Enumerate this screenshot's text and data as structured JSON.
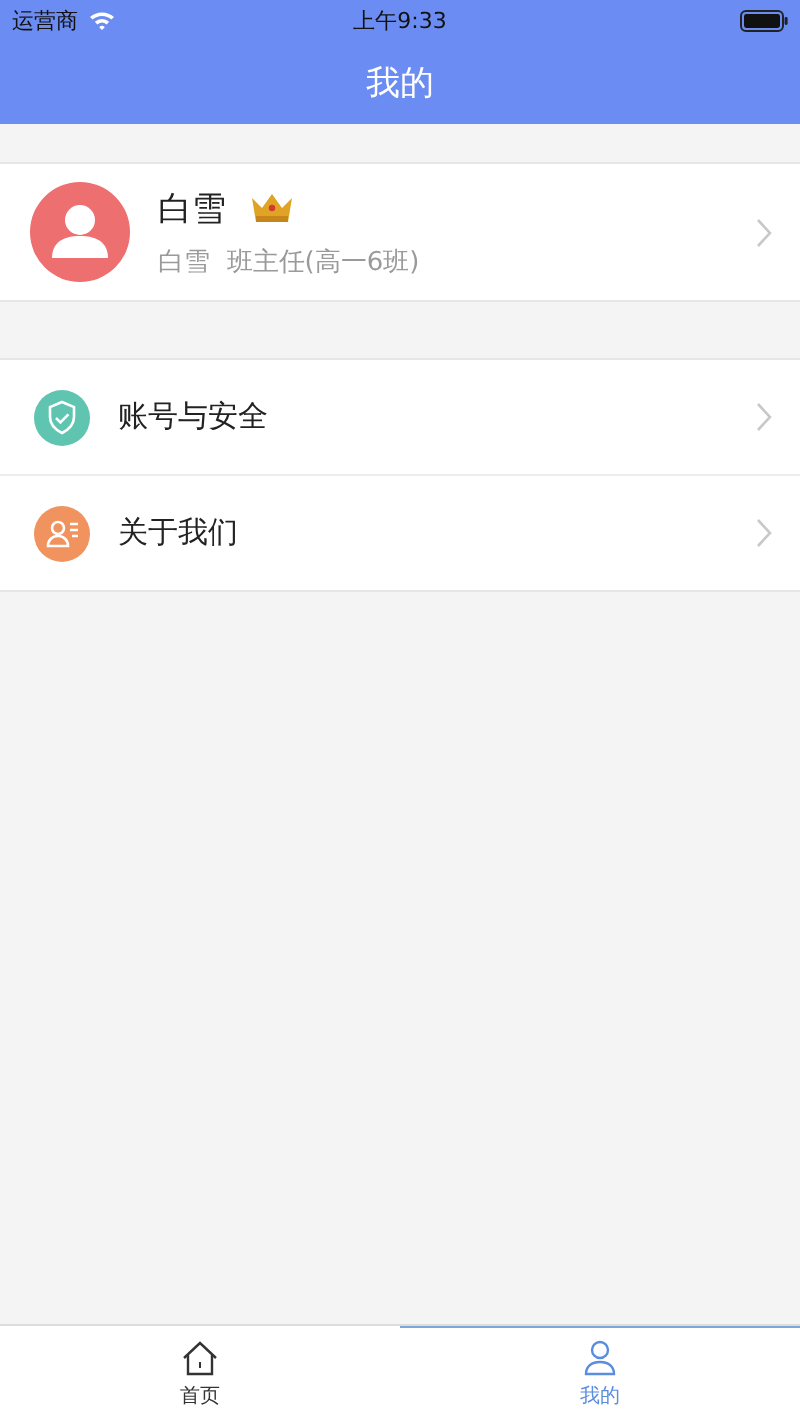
{
  "status_bar": {
    "carrier": "运营商",
    "time": "上午9:33"
  },
  "nav_bar": {
    "title": "我的"
  },
  "profile": {
    "name": "白雪",
    "vip": true,
    "subtitle": "白雪  班主任(高一6班)"
  },
  "menu": [
    {
      "label": "账号与安全",
      "kind": "shield",
      "color": "#5fc4b0"
    },
    {
      "label": "关于我们",
      "kind": "contact",
      "color": "#f0935e"
    }
  ],
  "tab_bar": [
    {
      "label": "首页",
      "kind": "home",
      "selected": false
    },
    {
      "label": "我的",
      "kind": "person",
      "selected": true
    }
  ]
}
